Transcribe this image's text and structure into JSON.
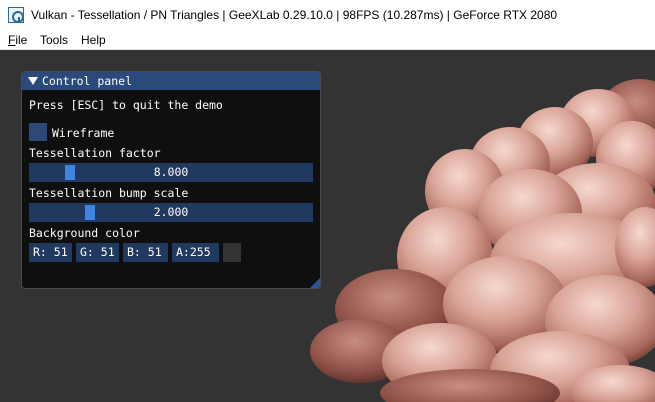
{
  "window": {
    "title": "Vulkan - Tessellation / PN Triangles | GeeXLab 0.29.10.0 | 98FPS (10.287ms) | GeForce RTX 2080"
  },
  "menu": [
    {
      "key": "F",
      "rest": "ile"
    },
    {
      "key": "",
      "rest": "Tools"
    },
    {
      "key": "",
      "rest": "Help"
    }
  ],
  "panel": {
    "title": "Control panel",
    "quit_hint": "Press [ESC] to quit the demo",
    "wireframe_label": "Wireframe",
    "wireframe_checked": false,
    "tess_factor_label": "Tessellation factor",
    "tess_factor_value": "8.000",
    "tess_factor_fraction": 0.125,
    "bump_scale_label": "Tessellation bump scale",
    "bump_scale_value": "2.000",
    "bump_scale_fraction": 0.2,
    "bg_label": "Background color",
    "bg_r": "R: 51",
    "bg_g": "G: 51",
    "bg_b": "B: 51",
    "bg_a": "A:255",
    "bg_swatch_color": "#333333"
  },
  "colors": {
    "background": "#333333",
    "panel_header": "#294a7a",
    "widget_frame": "#21395f",
    "slider_grab": "#3d85e0",
    "mesh_tone": "#c9948a"
  }
}
